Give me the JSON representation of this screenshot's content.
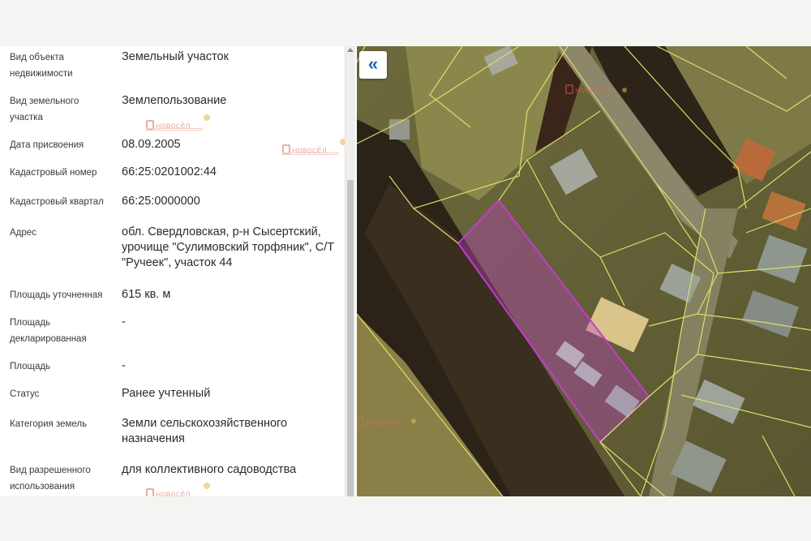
{
  "panel": {
    "rows": [
      {
        "label": "Вид объекта\nнедвижимости",
        "value": "Земельный участок"
      },
      {
        "label": "Вид земельного\nучастка",
        "value": "Землепользование"
      },
      {
        "label": "Дата присвоения",
        "value": "08.09.2005"
      },
      {
        "label": "Кадастровый номер",
        "value": "66:25:0201002:44"
      },
      {
        "label": "Кадастровый квартал",
        "value": "66:25:0000000"
      },
      {
        "label": "Адрес",
        "value": "обл. Свердловская, р-н Сысертский, урочище \"Сулимовский торфяник\", С/Т \"Ручеек\", участок 44"
      },
      {
        "label": "Площадь уточненная",
        "value": "615 кв. м"
      },
      {
        "label": "Площадь\nдекларированная",
        "value": "-"
      },
      {
        "label": "Площадь",
        "value": "-"
      },
      {
        "label": "Статус",
        "value": "Ранее учтенный"
      },
      {
        "label": "Категория земель",
        "value": "Земли сельскохозяйственного назначения"
      },
      {
        "label": "Вид разрешенного\nиспользования",
        "value": "для коллективного садоводства"
      }
    ]
  },
  "map": {
    "collapse_icon": "double-chevron-left-icon",
    "collapse_glyph": "«",
    "parcel_color": "#c43bd0",
    "boundary_color": "#d8e06a"
  },
  "watermark": {
    "brand": "новосёл",
    "icon": "novosel-logo-icon"
  }
}
